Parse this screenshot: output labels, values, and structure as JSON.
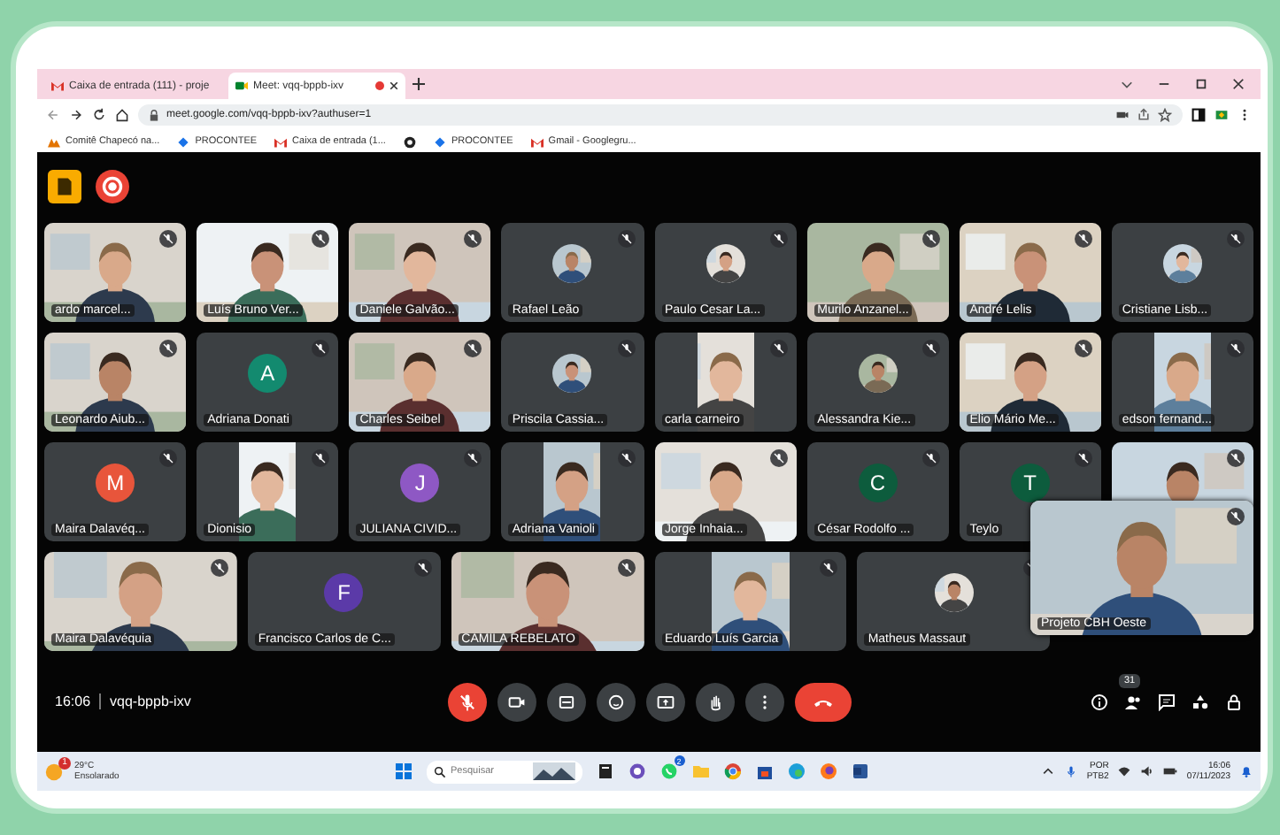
{
  "browser": {
    "tabs": [
      {
        "title": "Caixa de entrada (111) - proje",
        "kind": "mail",
        "selected": false
      },
      {
        "title": "Meet: vqq-bppb-ixv",
        "kind": "meet",
        "selected": true,
        "recording": true
      }
    ],
    "url": "meet.google.com/vqq-bppb-ixv?authuser=1",
    "bookmarks": [
      {
        "label": "Comitê Chapecó na...",
        "kind": "site"
      },
      {
        "label": "PROCONTEE",
        "kind": "diamond"
      },
      {
        "label": "Caixa de entrada (1...",
        "kind": "mail"
      },
      {
        "kind": "globe"
      },
      {
        "label": "PROCONTEE",
        "kind": "diamond"
      },
      {
        "label": "Gmail - Googlegru...",
        "kind": "mail"
      }
    ]
  },
  "meet": {
    "rows": [
      {
        "tiles": [
          {
            "name": "ardo marcel...",
            "kind": "video"
          },
          {
            "name": "Luís Bruno Ver...",
            "kind": "video"
          },
          {
            "name": "Daniele Galvão...",
            "kind": "video"
          },
          {
            "name": "Rafael Leão"
          },
          {
            "name": "Paulo Cesar La..."
          },
          {
            "name": "Murilo Anzanel...",
            "kind": "video"
          },
          {
            "name": "André Lelis",
            "kind": "video"
          },
          {
            "name": "Cristiane Lisb..."
          }
        ]
      },
      {
        "tiles": [
          {
            "name": "Leonardo Aiub...",
            "kind": "video"
          },
          {
            "name": "Adriana Donati",
            "kind": "letter",
            "initial": "A",
            "color": "#138a6f"
          },
          {
            "name": "Charles Seibel",
            "kind": "video"
          },
          {
            "name": "Priscila Cassia..."
          },
          {
            "name": "carla carneiro",
            "kind": "portrait"
          },
          {
            "name": "Alessandra Kie..."
          },
          {
            "name": "Elio Mário Me...",
            "kind": "video"
          },
          {
            "name": "edson fernand...",
            "kind": "portrait"
          }
        ]
      },
      {
        "tiles": [
          {
            "name": "Maira Dalavéq...",
            "kind": "letter",
            "initial": "M",
            "color": "#e8553b"
          },
          {
            "name": "Dionisio",
            "kind": "portrait"
          },
          {
            "name": "JULIANA CIVID...",
            "kind": "letter",
            "initial": "J",
            "color": "#8e58c4"
          },
          {
            "name": "Adriana Vanioli",
            "kind": "portrait"
          },
          {
            "name": "Jorge Inhaia...",
            "kind": "video"
          },
          {
            "name": "César Rodolfo ...",
            "kind": "letter",
            "initial": "C",
            "color": "#0d5c3d"
          },
          {
            "name": "Teylo",
            "kind": "letter",
            "initial": "T",
            "color": "#0d5c3d"
          },
          {
            "kind": "video"
          }
        ]
      },
      {
        "tiles": [
          {
            "name": "Maira Dalavéquia",
            "kind": "video"
          },
          {
            "name": "Francisco Carlos de C...",
            "kind": "letter",
            "initial": "F",
            "color": "#5b3aa8"
          },
          {
            "name": "CAMILA REBELATO",
            "kind": "video"
          },
          {
            "name": "Eduardo Luís Garcia",
            "kind": "portrait"
          },
          {
            "name": "Matheus Massaut"
          }
        ]
      }
    ],
    "self_view": {
      "name": "Projeto CBH Oeste"
    },
    "time": "16:06",
    "code": "vqq-bppb-ixv",
    "mic_on": false,
    "participants": "31"
  },
  "taskbar": {
    "temp": "29°C",
    "condition": "Ensolarado",
    "alert": "1",
    "search_placeholder": "Pesquisar",
    "whatsapp_badge": "2",
    "lang": "POR",
    "layout": "PTB2",
    "time": "16:06",
    "date": "07/11/2023"
  }
}
